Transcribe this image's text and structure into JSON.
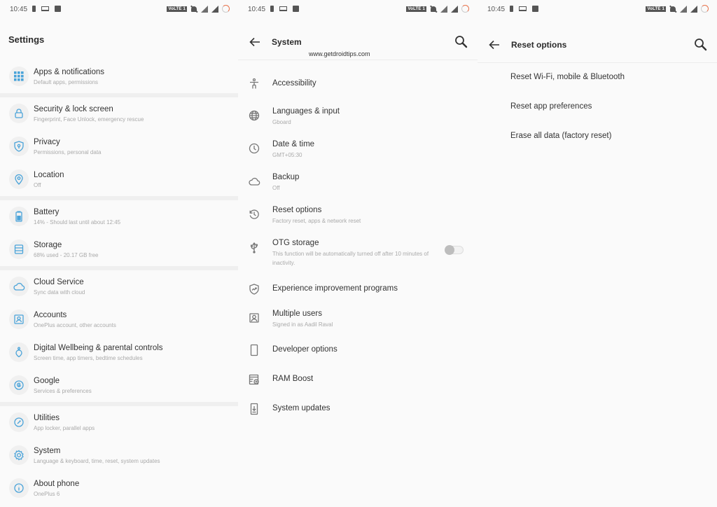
{
  "statusbar": {
    "time": "10:45",
    "volte_label": "VoLTE 1"
  },
  "colors": {
    "accent": "#4aa3d9",
    "background": "#fafafa",
    "section_gap": "#efefef",
    "ring": "#e8734c"
  },
  "settings": {
    "title": "Settings",
    "sections": [
      {
        "items": [
          {
            "icon": "apps-grid-icon",
            "title": "Apps & notifications",
            "subtitle": "Default apps, permissions"
          }
        ]
      },
      {
        "items": [
          {
            "icon": "lock-icon",
            "title": "Security & lock screen",
            "subtitle": "Fingerprint, Face Unlock, emergency rescue"
          },
          {
            "icon": "privacy-shield-icon",
            "title": "Privacy",
            "subtitle": "Permissions, personal data"
          },
          {
            "icon": "location-pin-icon",
            "title": "Location",
            "subtitle": "Off"
          }
        ]
      },
      {
        "items": [
          {
            "icon": "battery-icon",
            "title": "Battery",
            "subtitle": "14% - Should last until about 12:45"
          },
          {
            "icon": "storage-icon",
            "title": "Storage",
            "subtitle": "68% used - 20.17 GB free"
          }
        ]
      },
      {
        "items": [
          {
            "icon": "cloud-icon",
            "title": "Cloud Service",
            "subtitle": "Sync data with cloud"
          },
          {
            "icon": "account-icon",
            "title": "Accounts",
            "subtitle": "OnePlus account, other accounts"
          },
          {
            "icon": "wellbeing-icon",
            "title": "Digital Wellbeing & parental controls",
            "subtitle": "Screen time, app timers, bedtime schedules"
          },
          {
            "icon": "google-icon",
            "title": "Google",
            "subtitle": "Services & preferences"
          }
        ]
      },
      {
        "items": [
          {
            "icon": "utilities-icon",
            "title": "Utilities",
            "subtitle": "App locker, parallel apps"
          },
          {
            "icon": "gear-icon",
            "title": "System",
            "subtitle": "Language & keyboard, time, reset, system updates"
          },
          {
            "icon": "info-icon",
            "title": "About phone",
            "subtitle": "OnePlus 6"
          }
        ]
      }
    ]
  },
  "system": {
    "title": "System",
    "watermark": "www.getdroidtips.com",
    "items": [
      {
        "icon": "accessibility-icon",
        "title": "Accessibility",
        "subtitle": ""
      },
      {
        "icon": "globe-icon",
        "title": "Languages & input",
        "subtitle": "Gboard"
      },
      {
        "icon": "clock-icon",
        "title": "Date & time",
        "subtitle": "GMT+05:30"
      },
      {
        "icon": "cloud-icon",
        "title": "Backup",
        "subtitle": "Off"
      },
      {
        "icon": "history-icon",
        "title": "Reset options",
        "subtitle": "Factory reset, apps & network reset"
      },
      {
        "icon": "usb-icon",
        "title": "OTG storage",
        "subtitle": "This function will be automatically turned off after 10 minutes of inactivity.",
        "toggle": false
      },
      {
        "icon": "shield-trend-icon",
        "title": "Experience improvement programs",
        "subtitle": ""
      },
      {
        "icon": "user-icon",
        "title": "Multiple users",
        "subtitle": "Signed in as Aadil Raval"
      },
      {
        "icon": "phone-outline-icon",
        "title": "Developer options",
        "subtitle": ""
      },
      {
        "icon": "ram-boost-icon",
        "title": "RAM Boost",
        "subtitle": ""
      },
      {
        "icon": "system-update-icon",
        "title": "System updates",
        "subtitle": ""
      }
    ]
  },
  "reset": {
    "title": "Reset options",
    "items": [
      {
        "title": "Reset Wi-Fi, mobile & Bluetooth"
      },
      {
        "title": "Reset app preferences"
      },
      {
        "title": "Erase all data (factory reset)"
      }
    ]
  }
}
